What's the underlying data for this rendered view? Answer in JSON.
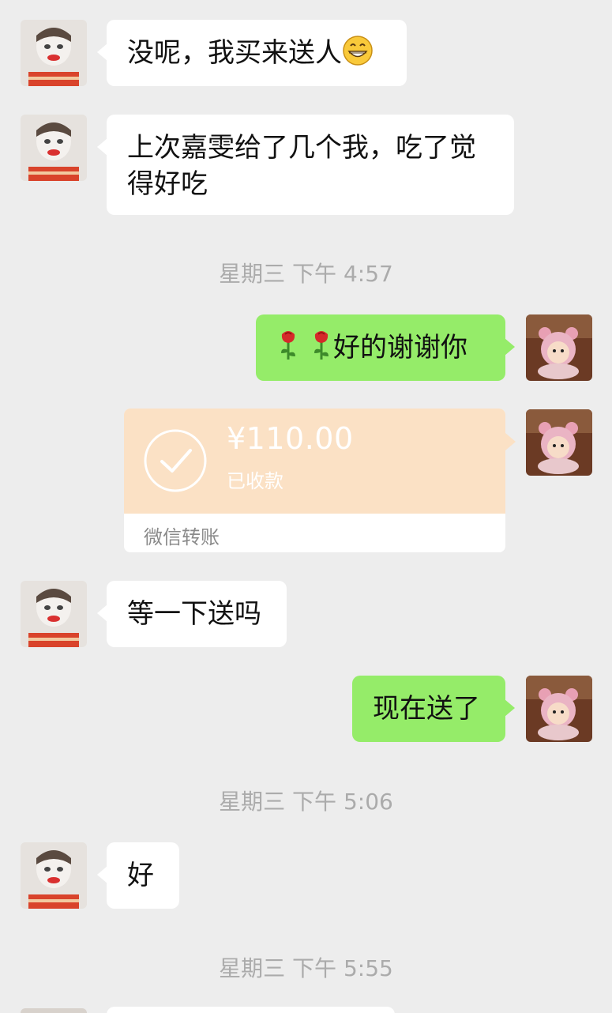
{
  "messages": [
    {
      "from": "other",
      "text": "没呢，我买来送人",
      "emoji": "grinning-face"
    },
    {
      "from": "other",
      "text_line1": "上次嘉雯给了几个我，吃了觉",
      "text_line2": "得好吃"
    },
    {
      "timestamp": "星期三 下午 4:57"
    },
    {
      "from": "self",
      "text": "好的谢谢你",
      "emoji": "rose-x2"
    },
    {
      "from": "self",
      "transfer": {
        "amount": "¥110.00",
        "status": "已收款",
        "label": "微信转账"
      }
    },
    {
      "from": "other",
      "text": "等一下送吗"
    },
    {
      "from": "self",
      "text": "现在送了"
    },
    {
      "timestamp": "星期三 下午 5:06"
    },
    {
      "from": "other",
      "text": "好"
    },
    {
      "timestamp": "星期三 下午 5:55"
    }
  ],
  "colors": {
    "background": "#ededed",
    "self_bubble": "#95ec69",
    "other_bubble": "#ffffff",
    "transfer_card": "#fbe1c5",
    "timestamp_text": "#ababab"
  }
}
